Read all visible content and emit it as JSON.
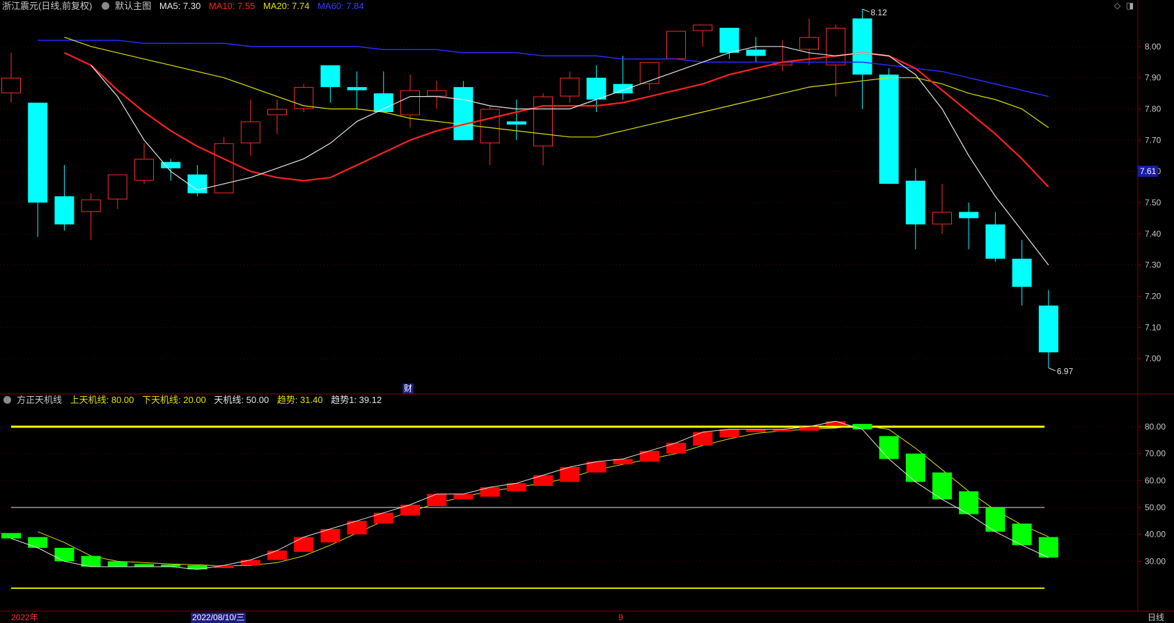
{
  "header": {
    "stock_title": "浙江震元(日线,前复权)",
    "template_label": "默认主图",
    "ma5": "MA5: 7.30",
    "ma10": "MA10: 7.55",
    "ma20": "MA20: 7.74",
    "ma60": "MA60: 7.84"
  },
  "indicator_header": {
    "name": "方正天机线",
    "upper": "上天机线: 80.00",
    "lower": "下天机线: 20.00",
    "mid": "天机线: 50.00",
    "trend": "趋势: 31.40",
    "trend1": "趋势1: 39.12"
  },
  "bottom_bar": {
    "year_label": "2022年",
    "cursor_date": "2022/08/10/三",
    "month_label": "9",
    "period_label": "日线"
  },
  "finance_marker": "财",
  "current_price_tag": "7.61",
  "colors": {
    "up": "#ff2b2b",
    "down": "#00ffff",
    "ma5": "#e6e6e6",
    "ma10": "#ff2020",
    "ma20": "#e0e000",
    "ma60": "#2a2aff",
    "trend_up": "#ff0000",
    "trend_down": "#00ff00"
  },
  "chart_data": [
    {
      "type": "candlestick",
      "ylim": [
        6.9,
        8.1
      ],
      "y_ticks": [
        "8.00",
        "7.90",
        "7.80",
        "7.70",
        "7.60",
        "7.50",
        "7.40",
        "7.30",
        "7.20",
        "7.10",
        "7.00"
      ],
      "high_annotation": "8.12",
      "low_annotation": "6.97",
      "candles": [
        {
          "o": 7.85,
          "h": 7.98,
          "l": 7.82,
          "c": 7.9
        },
        {
          "o": 7.82,
          "h": 7.82,
          "l": 7.39,
          "c": 7.5
        },
        {
          "o": 7.52,
          "h": 7.62,
          "l": 7.41,
          "c": 7.43
        },
        {
          "o": 7.47,
          "h": 7.53,
          "l": 7.38,
          "c": 7.51
        },
        {
          "o": 7.51,
          "h": 7.59,
          "l": 7.48,
          "c": 7.59
        },
        {
          "o": 7.57,
          "h": 7.69,
          "l": 7.56,
          "c": 7.64
        },
        {
          "o": 7.63,
          "h": 7.64,
          "l": 7.57,
          "c": 7.61
        },
        {
          "o": 7.59,
          "h": 7.62,
          "l": 7.52,
          "c": 7.53
        },
        {
          "o": 7.53,
          "h": 7.71,
          "l": 7.53,
          "c": 7.69
        },
        {
          "o": 7.69,
          "h": 7.83,
          "l": 7.65,
          "c": 7.76
        },
        {
          "o": 7.78,
          "h": 7.83,
          "l": 7.72,
          "c": 7.8
        },
        {
          "o": 7.8,
          "h": 7.88,
          "l": 7.79,
          "c": 7.87
        },
        {
          "o": 7.94,
          "h": 7.94,
          "l": 7.82,
          "c": 7.87
        },
        {
          "o": 7.87,
          "h": 7.92,
          "l": 7.8,
          "c": 7.86
        },
        {
          "o": 7.85,
          "h": 7.92,
          "l": 7.79,
          "c": 7.79
        },
        {
          "o": 7.78,
          "h": 7.91,
          "l": 7.74,
          "c": 7.86
        },
        {
          "o": 7.84,
          "h": 7.89,
          "l": 7.8,
          "c": 7.86
        },
        {
          "o": 7.87,
          "h": 7.89,
          "l": 7.7,
          "c": 7.7
        },
        {
          "o": 7.69,
          "h": 7.81,
          "l": 7.62,
          "c": 7.8
        },
        {
          "o": 7.76,
          "h": 7.83,
          "l": 7.7,
          "c": 7.75
        },
        {
          "o": 7.68,
          "h": 7.85,
          "l": 7.62,
          "c": 7.84
        },
        {
          "o": 7.84,
          "h": 7.92,
          "l": 7.82,
          "c": 7.9
        },
        {
          "o": 7.9,
          "h": 7.94,
          "l": 7.79,
          "c": 7.83
        },
        {
          "o": 7.88,
          "h": 7.97,
          "l": 7.83,
          "c": 7.85
        },
        {
          "o": 7.88,
          "h": 7.95,
          "l": 7.86,
          "c": 7.95
        },
        {
          "o": 7.96,
          "h": 8.05,
          "l": 7.96,
          "c": 8.05
        },
        {
          "o": 8.05,
          "h": 8.07,
          "l": 8.0,
          "c": 8.07
        },
        {
          "o": 8.06,
          "h": 8.06,
          "l": 7.96,
          "c": 7.98
        },
        {
          "o": 7.99,
          "h": 8.03,
          "l": 7.95,
          "c": 7.97
        },
        {
          "o": 7.94,
          "h": 8.02,
          "l": 7.92,
          "c": 7.95
        },
        {
          "o": 7.99,
          "h": 8.09,
          "l": 7.94,
          "c": 8.03
        },
        {
          "o": 7.94,
          "h": 8.07,
          "l": 7.84,
          "c": 8.06
        },
        {
          "o": 8.09,
          "h": 8.12,
          "l": 7.8,
          "c": 7.91
        },
        {
          "o": 7.91,
          "h": 7.93,
          "l": 7.56,
          "c": 7.56
        },
        {
          "o": 7.57,
          "h": 7.61,
          "l": 7.35,
          "c": 7.43
        },
        {
          "o": 7.43,
          "h": 7.56,
          "l": 7.4,
          "c": 7.47
        },
        {
          "o": 7.47,
          "h": 7.5,
          "l": 7.35,
          "c": 7.45
        },
        {
          "o": 7.43,
          "h": 7.47,
          "l": 7.31,
          "c": 7.32
        },
        {
          "o": 7.32,
          "h": 7.38,
          "l": 7.17,
          "c": 7.23
        },
        {
          "o": 7.17,
          "h": 7.22,
          "l": 6.97,
          "c": 7.02
        }
      ],
      "ma5": [
        7.94,
        7.84,
        7.7,
        7.6,
        7.54,
        7.56,
        7.58,
        7.61,
        7.64,
        7.69,
        7.76,
        7.8,
        7.84,
        7.84,
        7.83,
        7.81,
        7.8,
        7.8,
        7.8,
        7.83,
        7.86,
        7.89,
        7.92,
        7.95,
        7.98,
        8.0,
        8.0,
        7.98,
        7.97,
        7.98,
        7.97,
        7.91,
        7.8,
        7.65,
        7.52,
        7.41,
        7.3
      ],
      "ma10": [
        7.98,
        7.94,
        7.86,
        7.79,
        7.73,
        7.68,
        7.64,
        7.6,
        7.58,
        7.57,
        7.58,
        7.62,
        7.66,
        7.7,
        7.73,
        7.75,
        7.77,
        7.79,
        7.81,
        7.81,
        7.81,
        7.82,
        7.84,
        7.86,
        7.88,
        7.91,
        7.93,
        7.95,
        7.96,
        7.97,
        7.98,
        7.97,
        7.93,
        7.86,
        7.79,
        7.72,
        7.64,
        7.55
      ],
      "ma20": [
        8.03,
        8.0,
        7.98,
        7.96,
        7.94,
        7.92,
        7.9,
        7.87,
        7.84,
        7.81,
        7.8,
        7.8,
        7.79,
        7.77,
        7.76,
        7.75,
        7.74,
        7.73,
        7.72,
        7.71,
        7.71,
        7.73,
        7.75,
        7.77,
        7.79,
        7.81,
        7.83,
        7.85,
        7.87,
        7.88,
        7.89,
        7.9,
        7.9,
        7.88,
        7.85,
        7.83,
        7.8,
        7.74
      ],
      "ma60": [
        8.02,
        8.02,
        8.02,
        8.02,
        8.01,
        8.01,
        8.01,
        8.01,
        8.0,
        8.0,
        8.0,
        8.0,
        8.0,
        7.99,
        7.99,
        7.99,
        7.98,
        7.98,
        7.98,
        7.97,
        7.97,
        7.97,
        7.96,
        7.96,
        7.96,
        7.95,
        7.95,
        7.95,
        7.95,
        7.95,
        7.95,
        7.95,
        7.94,
        7.93,
        7.92,
        7.9,
        7.88,
        7.86,
        7.84
      ]
    },
    {
      "type": "indicator",
      "ylim": [
        12,
        88
      ],
      "y_ticks": [
        "80.00",
        "70.00",
        "60.00",
        "50.00",
        "40.00",
        "30.00"
      ],
      "levels": [
        80,
        50,
        20
      ],
      "trend_bars": [
        {
          "o": 40.5,
          "c": 38.5
        },
        {
          "o": 39,
          "c": 35
        },
        {
          "o": 35,
          "c": 30
        },
        {
          "o": 32,
          "c": 28
        },
        {
          "o": 30,
          "c": 28
        },
        {
          "o": 29,
          "c": 28
        },
        {
          "o": 28.8,
          "c": 28
        },
        {
          "o": 28.5,
          "c": 27
        },
        {
          "o": 27.5,
          "c": 28.5
        },
        {
          "o": 28.5,
          "c": 30.5
        },
        {
          "o": 30.5,
          "c": 34
        },
        {
          "o": 33.5,
          "c": 39
        },
        {
          "o": 37,
          "c": 42
        },
        {
          "o": 40,
          "c": 45
        },
        {
          "o": 44,
          "c": 48
        },
        {
          "o": 47,
          "c": 51
        },
        {
          "o": 50.5,
          "c": 55
        },
        {
          "o": 53,
          "c": 55
        },
        {
          "o": 54,
          "c": 57.5
        },
        {
          "o": 56,
          "c": 59
        },
        {
          "o": 58,
          "c": 62
        },
        {
          "o": 59.5,
          "c": 65
        },
        {
          "o": 63,
          "c": 67
        },
        {
          "o": 66,
          "c": 68
        },
        {
          "o": 67,
          "c": 71
        },
        {
          "o": 70,
          "c": 74
        },
        {
          "o": 73,
          "c": 78
        },
        {
          "o": 76,
          "c": 79
        },
        {
          "o": 78,
          "c": 79
        },
        {
          "o": 78.5,
          "c": 79
        },
        {
          "o": 78.5,
          "c": 80
        },
        {
          "o": 80.5,
          "c": 82
        },
        {
          "o": 81,
          "c": 79
        },
        {
          "o": 76.5,
          "c": 68
        },
        {
          "o": 70,
          "c": 59.5
        },
        {
          "o": 63,
          "c": 53
        },
        {
          "o": 56,
          "c": 47.5
        },
        {
          "o": 50,
          "c": 41
        },
        {
          "o": 44,
          "c": 36
        },
        {
          "o": 39,
          "c": 31.4
        }
      ],
      "trend1_line": [
        41,
        37,
        32,
        30,
        29.5,
        29,
        28.7,
        28.3,
        28.5,
        29.5,
        32,
        36,
        40.5,
        45,
        48.5,
        51.5,
        54,
        56,
        57.5,
        59,
        61,
        64,
        66,
        68,
        70,
        73,
        75.5,
        77.5,
        78.5,
        79,
        79.5,
        80.5,
        79,
        72,
        64,
        56,
        49,
        43.5,
        39.12
      ]
    }
  ]
}
